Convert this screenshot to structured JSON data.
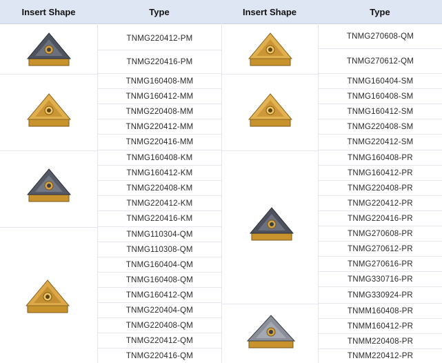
{
  "headers": {
    "left_shape": "Insert Shape",
    "left_type": "Type",
    "right_shape": "Insert Shape",
    "right_type": "Type"
  },
  "left": {
    "group1": [
      "TNMG220412-PM",
      "TNMG220416-PM"
    ],
    "group2": [
      "TNMG160408-MM",
      "TNMG160412-MM",
      "TNMG220408-MM",
      "TNMG220412-MM",
      "TNMG220416-MM"
    ],
    "group3": [
      "TNMG160408-KM",
      "TNMG160412-KM",
      "TNMG220408-KM",
      "TNMG220412-KM",
      "TNMG220416-KM"
    ],
    "group4": [
      "TNMG110304-QM",
      "TNMG110308-QM",
      "TNMG160404-QM",
      "TNMG160408-QM",
      "TNMG160412-QM",
      "TNMG220404-QM",
      "TNMG220408-QM",
      "TNMG220412-QM",
      "TNMG220416-QM"
    ]
  },
  "right": {
    "group1": [
      "TNMG270608-QM",
      "TNMG270612-QM"
    ],
    "group2": [
      "TNMG160404-SM",
      "TNMG160408-SM",
      "TNMG160412-SM",
      "TNMG220408-SM",
      "TNMG220412-SM"
    ],
    "group3": [
      "TNMG160408-PR",
      "TNMG160412-PR",
      "TNMG220408-PR",
      "TNMG220412-PR",
      "TNMG220416-PR",
      "TNMG270608-PR",
      "TNMG270612-PR",
      "TNMG270616-PR",
      "TNMG330716-PR",
      "TNMG330924-PR"
    ],
    "group4": [
      "TNMM160408-PR",
      "TNMM160412-PR",
      "TNMM220408-PR",
      "TNMM220412-PR"
    ]
  },
  "icons": {
    "gold_insert": "triangle-insert-gold-icon",
    "dark_insert": "triangle-insert-dark-icon"
  },
  "colors": {
    "header_bg": "#dfe6f3",
    "gold": "#d9a53a",
    "dark": "#5a5f6a"
  }
}
